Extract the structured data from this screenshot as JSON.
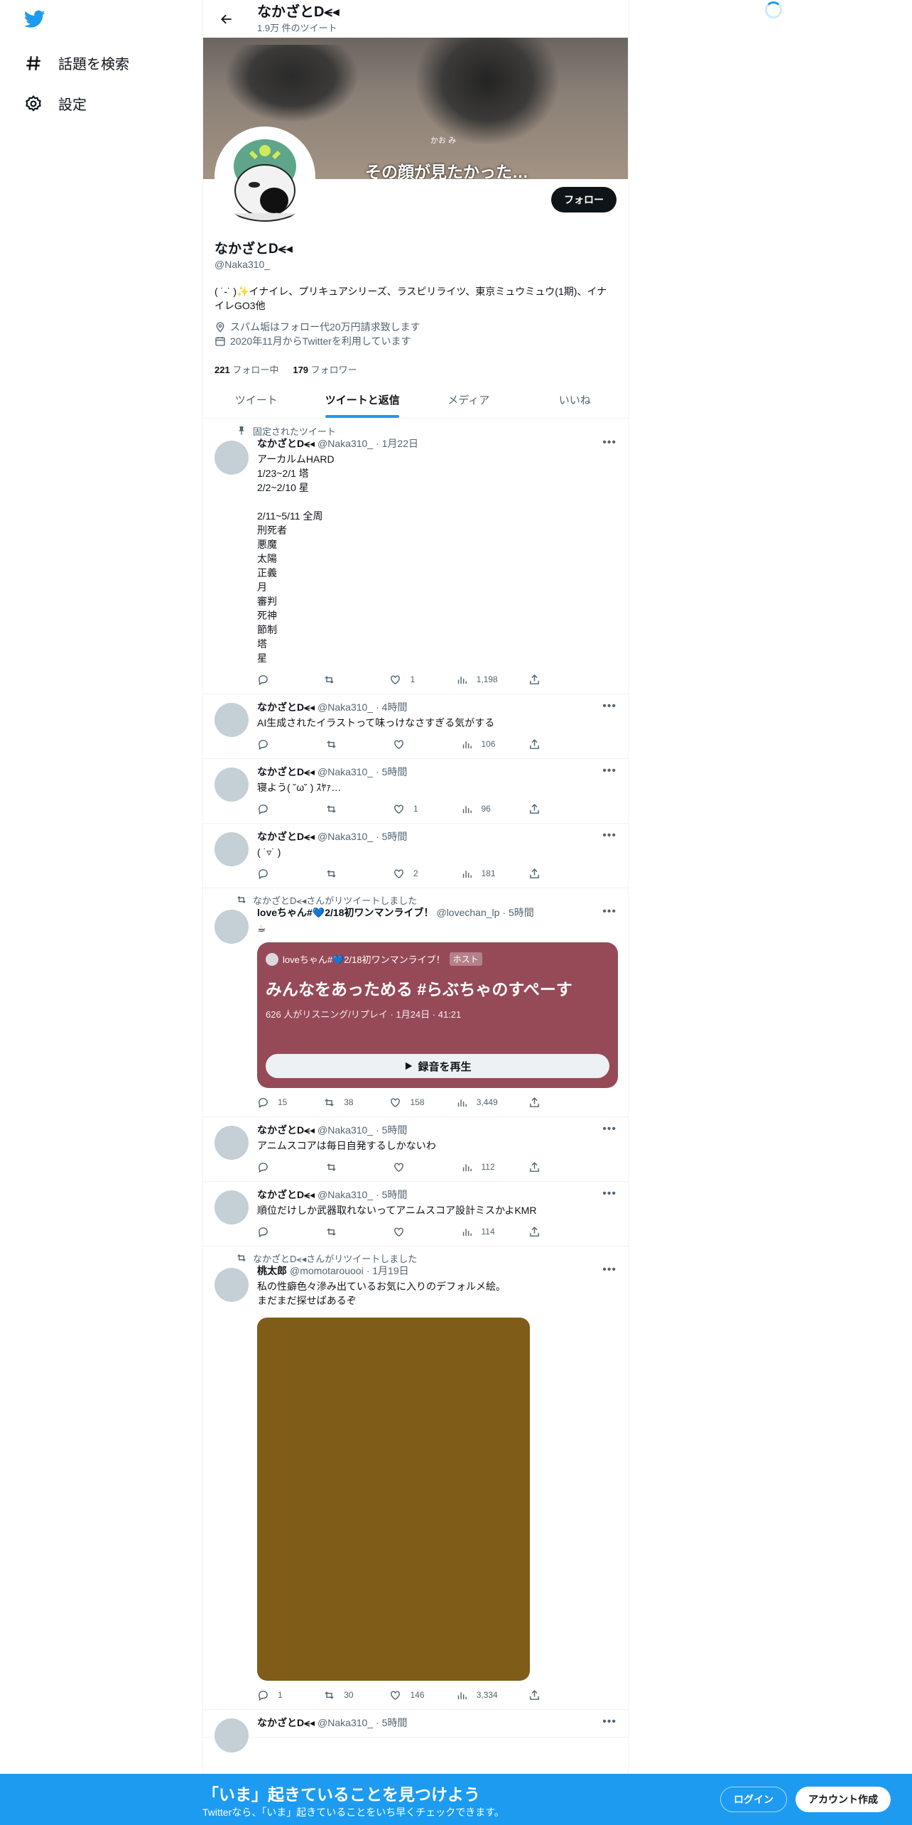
{
  "nav": {
    "logo_icon": "twitter-bird-icon",
    "items": [
      {
        "label": "話題を検索",
        "icon": "hashtag-icon"
      },
      {
        "label": "設定",
        "icon": "gear-icon"
      }
    ]
  },
  "header": {
    "title": "なかざとD⪪◂",
    "subtitle": "1.9万 件のツイート"
  },
  "banner": {
    "caption": "その顔が見たかった…",
    "caption_small": "かお み"
  },
  "profile": {
    "name": "なかざとD⪪◂",
    "handle": "@Naka310_",
    "bio": "( ˙-˙ )✨イナイレ、プリキュアシリーズ、ラスピリライツ、東京ミュウミュウ(1期)、イナイレGO3他",
    "location": "スパム垢はフォロー代20万円請求致します",
    "joined": "2020年11月からTwitterを利用しています",
    "following_count": "221",
    "following_label": "フォロー中",
    "followers_count": "179",
    "followers_label": "フォロワー",
    "follow_button": "フォロー"
  },
  "tabs": [
    {
      "label": "ツイート",
      "active": false
    },
    {
      "label": "ツイートと返信",
      "active": true
    },
    {
      "label": "メディア",
      "active": false
    },
    {
      "label": "いいね",
      "active": false
    }
  ],
  "tweets": [
    {
      "social": "固定されたツイート",
      "name": "なかざとD⪪◂",
      "handle": "@Naka310_",
      "time": "· 1月22日",
      "text": "アーカルムHARD\n1/23~2/1 塔\n2/2~2/10 星\n\n2/11~5/11 全周\n刑死者\n悪魔\n太陽\n正義\n月\n審判\n死神\n節制\n塔\n星",
      "replies": "",
      "retweets": "",
      "likes": "1",
      "views": "1,198"
    },
    {
      "social": "",
      "name": "なかざとD⪪◂",
      "handle": "@Naka310_",
      "time": "· 4時間",
      "text": "AI生成されたイラストって味っけなさすぎる気がする",
      "replies": "",
      "retweets": "",
      "likes": "",
      "views": "106"
    },
    {
      "social": "",
      "name": "なかざとD⪪◂",
      "handle": "@Naka310_",
      "time": "· 5時間",
      "text": "寝よう( ˘ω˘ ) ｽﾔｧ…",
      "replies": "",
      "retweets": "",
      "likes": "1",
      "views": "96"
    },
    {
      "social": "",
      "name": "なかざとD⪪◂",
      "handle": "@Naka310_",
      "time": "· 5時間",
      "text": "( ˙▿˙ )",
      "replies": "",
      "retweets": "",
      "likes": "2",
      "views": "181"
    },
    {
      "social": "なかざとD⪪◂さんがリツイートしました",
      "name": "loveちゃん#💙2/18初ワンマンライブ！",
      "handle": "@lovechan_lp",
      "time": "· 5時間",
      "text": "☕",
      "replies": "15",
      "retweets": "38",
      "likes": "158",
      "views": "3,449"
    },
    {
      "social": "",
      "name": "なかざとD⪪◂",
      "handle": "@Naka310_",
      "time": "· 5時間",
      "text": "アニムスコアは毎日自発するしかないわ",
      "replies": "",
      "retweets": "",
      "likes": "",
      "views": "112"
    },
    {
      "social": "",
      "name": "なかざとD⪪◂",
      "handle": "@Naka310_",
      "time": "· 5時間",
      "text": "順位だけしか武器取れないってアニムスコア設計ミスかよKMR",
      "replies": "",
      "retweets": "",
      "likes": "",
      "views": "114"
    },
    {
      "social": "なかざとD⪪◂さんがリツイートしました",
      "name": "桃太郎",
      "handle": "@momotarouooi",
      "time": "· 1月19日",
      "text": "私の性癖色々滲み出ているお気に入りのデフォルメ絵。\nまだまだ探せばあるぞ",
      "replies": "1",
      "retweets": "30",
      "likes": "146",
      "views": "3,334"
    },
    {
      "social": "",
      "name": "なかざとD⪪◂",
      "handle": "@Naka310_",
      "time": "· 5時間",
      "text": "",
      "replies": "",
      "retweets": "",
      "likes": "",
      "views": ""
    }
  ],
  "space_card": {
    "host_name": "loveちゃん#💙2/18初ワンマンライブ！",
    "host_badge": "ホスト",
    "title": "みんなをあっためる #らぶちゃのすぺーす",
    "stats": "626 人がリスニング/リプレイ · 1月24日 · 41:21",
    "play_label": "録音を再生",
    "color": "#964a58"
  },
  "media_color": "#7f5c18",
  "bottom_bar": {
    "title": "「いま」起きていることを見つけよう",
    "subtitle": "Twitterなら、「いま」起きていることをいち早くチェックできます。",
    "login": "ログイン",
    "signup": "アカウント作成",
    "color": "#1d9bf0"
  }
}
